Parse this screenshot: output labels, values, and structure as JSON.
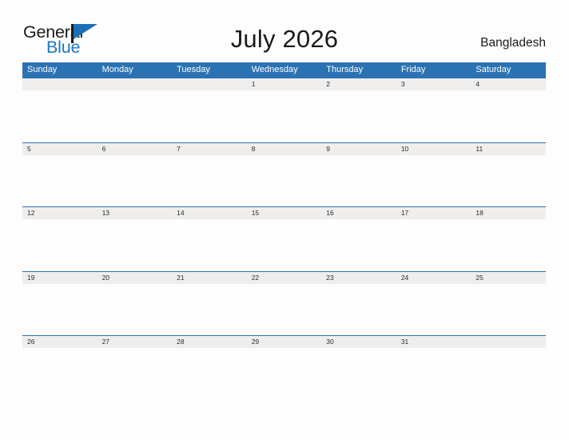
{
  "brand": {
    "name_part1": "General",
    "name_part2": "Blue",
    "flag_icon": "flag-triangle-icon",
    "accent_color": "#1b77c4"
  },
  "header": {
    "title": "July 2026",
    "country": "Bangladesh"
  },
  "calendar": {
    "month": "July",
    "year": "2026",
    "header_color": "#2b72b3",
    "band_color": "#efeeed",
    "weekdays": [
      "Sunday",
      "Monday",
      "Tuesday",
      "Wednesday",
      "Thursday",
      "Friday",
      "Saturday"
    ],
    "weeks": [
      [
        "",
        "",
        "",
        "1",
        "2",
        "3",
        "4"
      ],
      [
        "5",
        "6",
        "7",
        "8",
        "9",
        "10",
        "11"
      ],
      [
        "12",
        "13",
        "14",
        "15",
        "16",
        "17",
        "18"
      ],
      [
        "19",
        "20",
        "21",
        "22",
        "23",
        "24",
        "25"
      ],
      [
        "26",
        "27",
        "28",
        "29",
        "30",
        "31",
        ""
      ]
    ]
  }
}
